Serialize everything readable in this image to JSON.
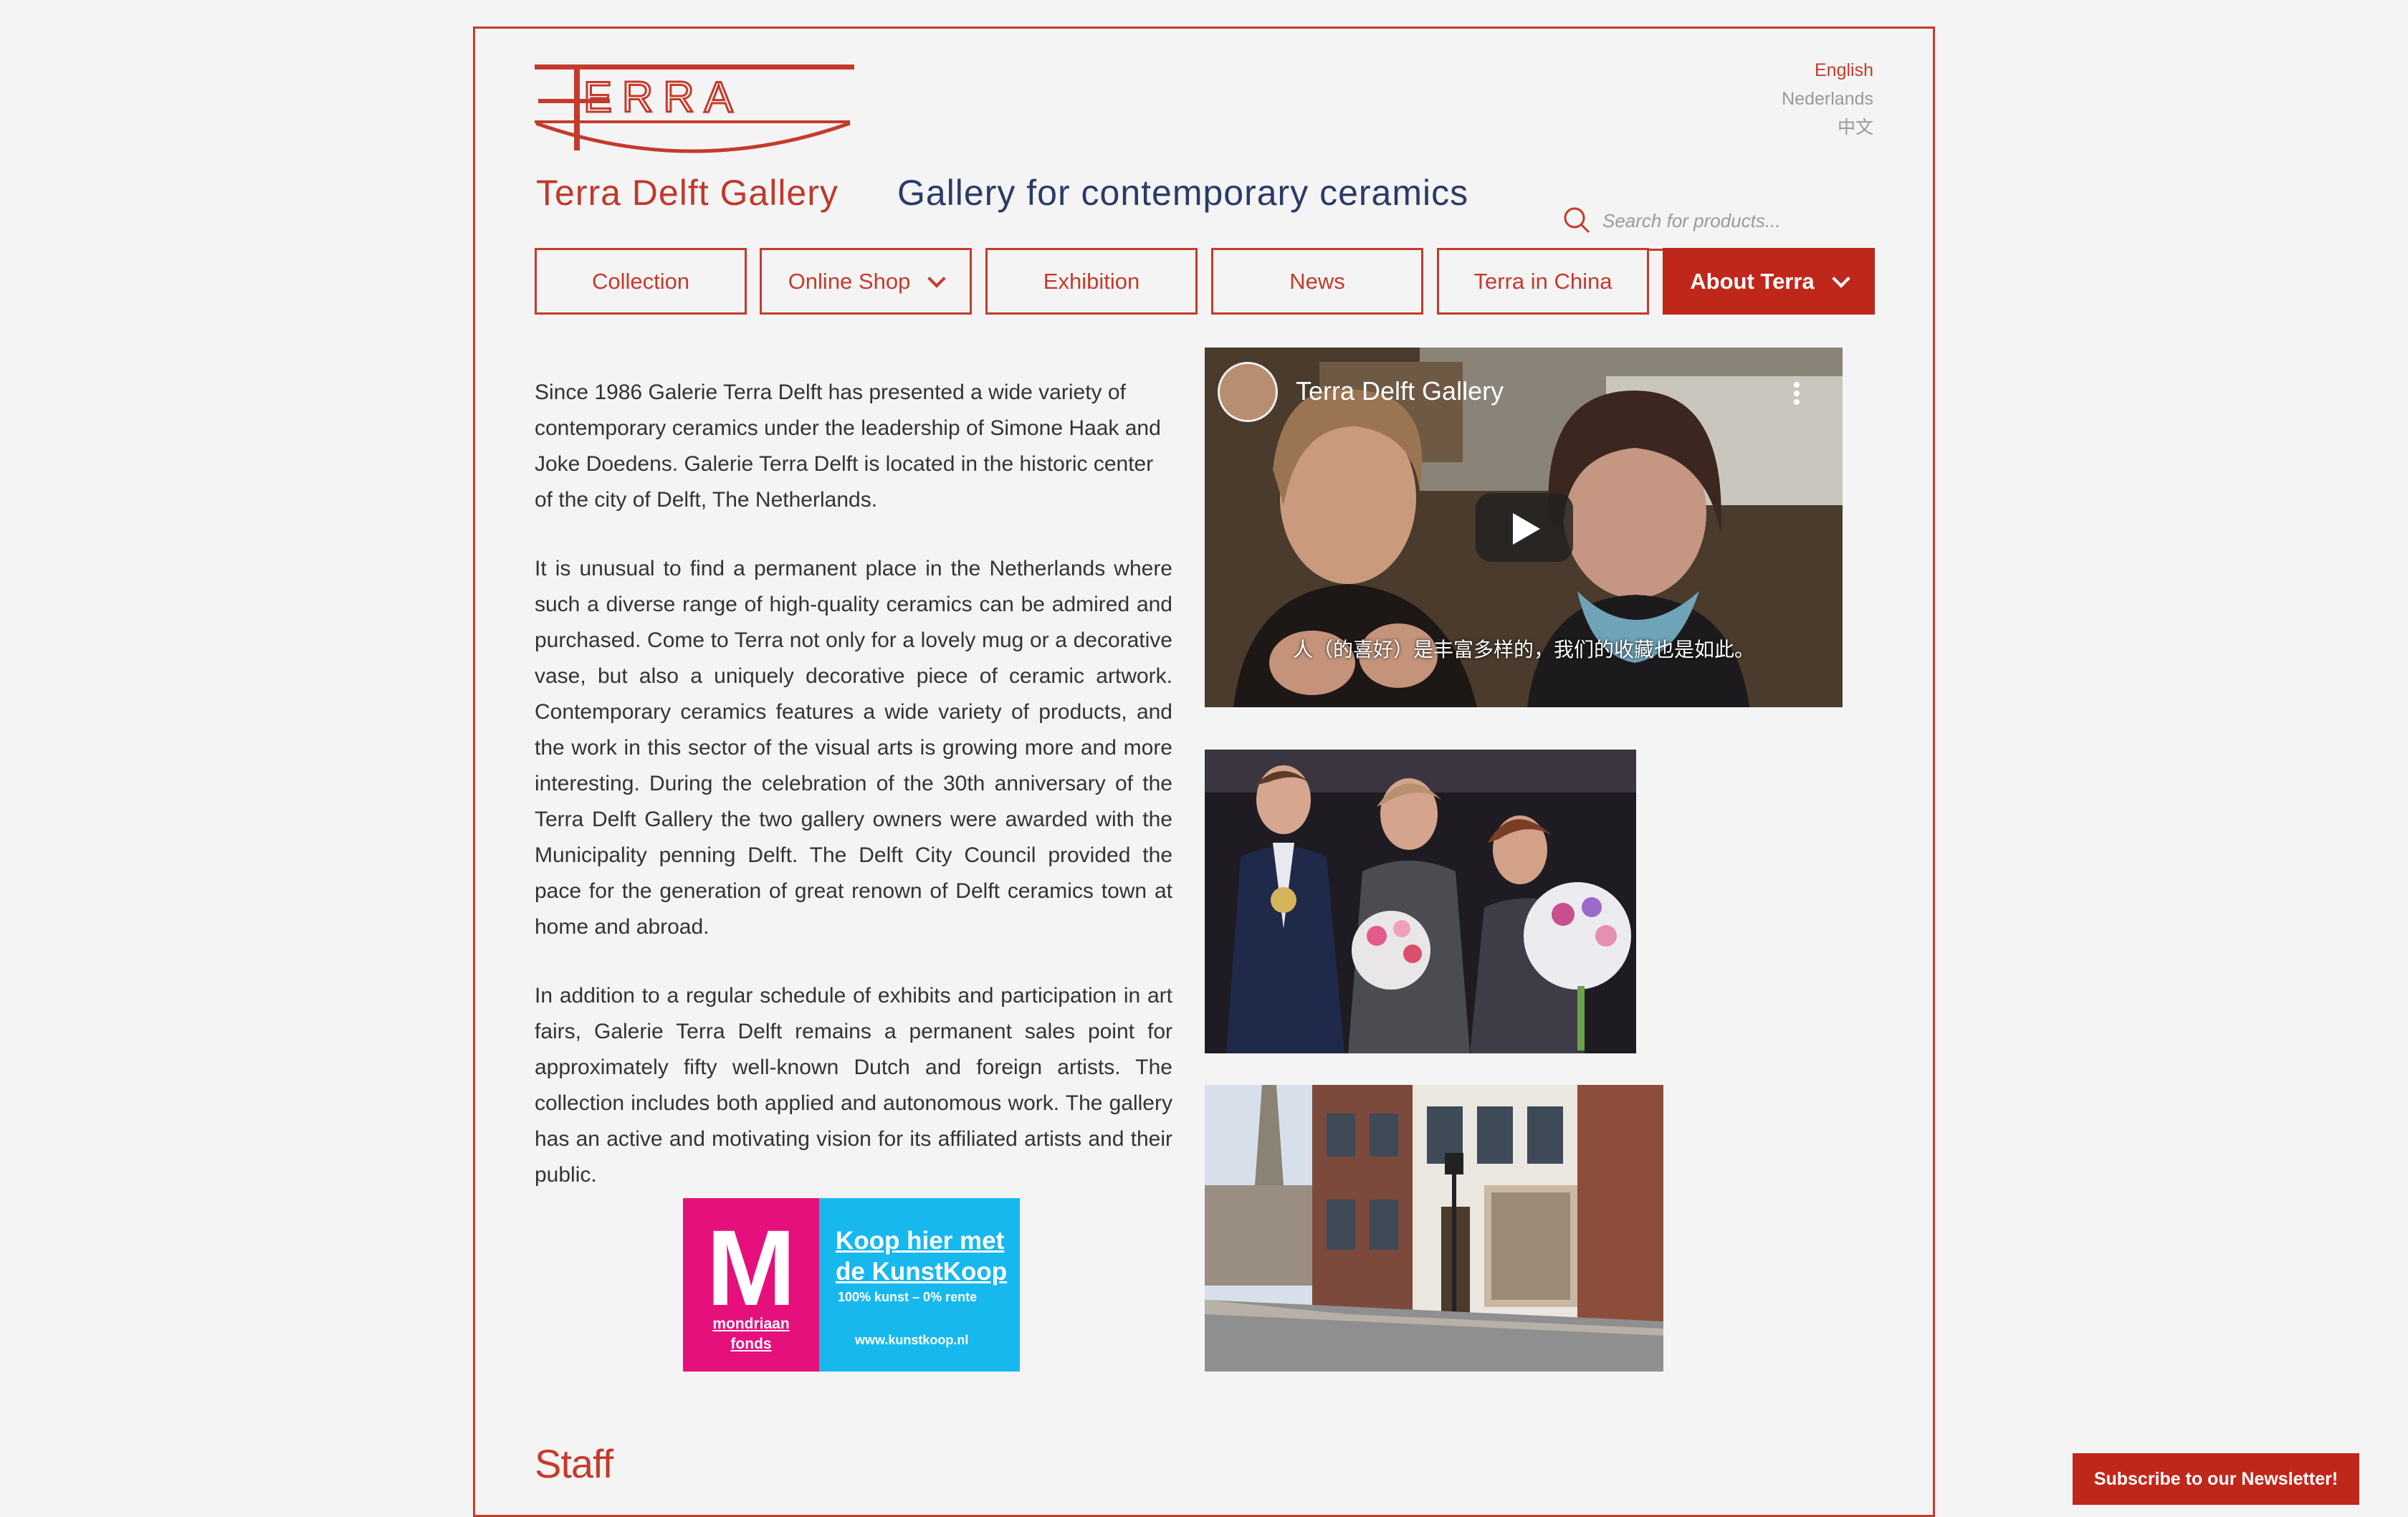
{
  "header": {
    "logo_text": "TERRA",
    "brand_name": "Terra Delft Gallery",
    "tagline": "Gallery for contemporary ceramics"
  },
  "languages": [
    {
      "label": "English",
      "active": true
    },
    {
      "label": "Nederlands",
      "active": false
    },
    {
      "label": "中文",
      "active": false
    }
  ],
  "search": {
    "placeholder": "Search for products..."
  },
  "nav": [
    {
      "label": "Collection",
      "dropdown": false,
      "active": false
    },
    {
      "label": "Online Shop",
      "dropdown": true,
      "active": false
    },
    {
      "label": "Exhibition",
      "dropdown": false,
      "active": false
    },
    {
      "label": "News",
      "dropdown": false,
      "active": false
    },
    {
      "label": "Terra in China",
      "dropdown": false,
      "active": false
    },
    {
      "label": "About Terra",
      "dropdown": true,
      "active": true
    }
  ],
  "content": {
    "paragraphs": [
      "Since 1986 Galerie Terra Delft has presented a wide variety of contemporary ceramics under the leadership of Simone Haak and Joke Doedens. Galerie Terra Delft is located in the historic center of the city of Delft, The Netherlands.",
      "It is unusual to find a permanent place in the Netherlands where such a diverse range of high-quality ceramics can be admired and purchased. Come to Terra not only for a lovely mug or a decorative vase, but also a uniquely decorative piece of ceramic artwork. Contemporary ceramics features a wide variety of products, and the work in this sector of the visual arts is growing more and more interesting. During the celebration of the 30th anniversary of the Terra Delft Gallery the two gallery owners were awarded with the Municipality penning Delft. The Delft City Council provided the pace for the generation of great renown of Delft ceramics town at home and abroad.",
      "In addition to a regular schedule of exhibits and participation in art fairs, Galerie Terra Delft remains a permanent sales point for approximately fifty well-known Dutch and foreign artists. The collection includes both applied and autonomous work. The gallery has an active and motivating vision for its affiliated artists and their public."
    ]
  },
  "banner": {
    "m_letter": "M",
    "fund_line1": "mondriaan",
    "fund_line2": "fonds",
    "koop_line1": "Koop hier met",
    "koop_line2": "de KunstKoop",
    "rate": "100% kunst – 0% rente",
    "url": "www.kunstkoop.nl"
  },
  "video": {
    "title": "Terra Delft Gallery",
    "caption": "人（的喜好）是丰富多样的，我们的收藏也是如此。"
  },
  "staff_heading": "Staff",
  "newsletter_label": "Subscribe to our Newsletter!",
  "colors": {
    "accent": "#c53a2c",
    "accent_dark": "#c0271b",
    "tagline": "#2b3a67",
    "background": "#f4f4f4"
  }
}
